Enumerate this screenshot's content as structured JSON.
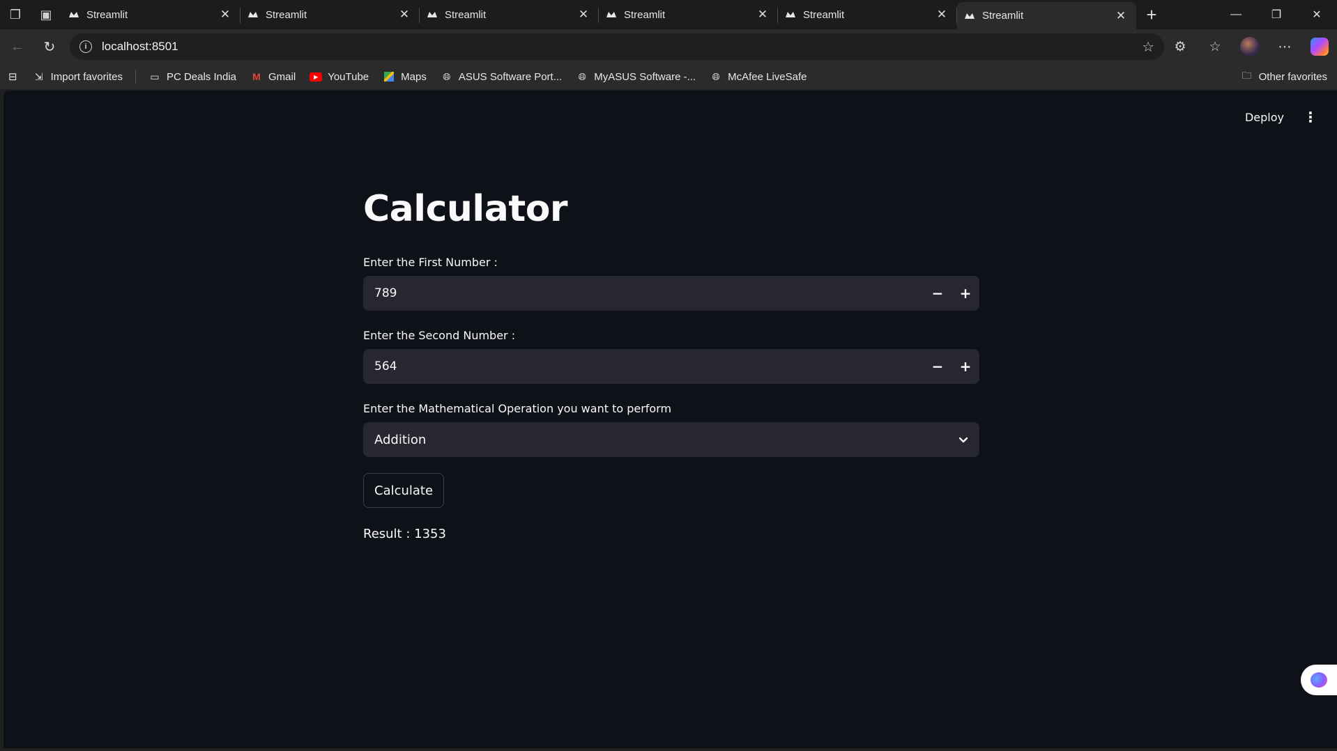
{
  "browser": {
    "tabs": [
      {
        "title": "Streamlit"
      },
      {
        "title": "Streamlit"
      },
      {
        "title": "Streamlit"
      },
      {
        "title": "Streamlit"
      },
      {
        "title": "Streamlit"
      },
      {
        "title": "Streamlit",
        "active": true
      }
    ],
    "url": "localhost:8501",
    "favorites": [
      {
        "label": "Import favorites",
        "icon": "import-icon"
      },
      {
        "label": "PC Deals India",
        "icon": "deals-icon"
      },
      {
        "label": "Gmail",
        "icon": "gmail-icon"
      },
      {
        "label": "YouTube",
        "icon": "youtube-icon"
      },
      {
        "label": "Maps",
        "icon": "maps-icon"
      },
      {
        "label": "ASUS Software Port...",
        "icon": "globe-icon"
      },
      {
        "label": "MyASUS Software -...",
        "icon": "globe-icon"
      },
      {
        "label": "McAfee LiveSafe",
        "icon": "globe-icon"
      }
    ],
    "other_favorites": "Other favorites"
  },
  "app": {
    "deploy_label": "Deploy",
    "title": "Calculator",
    "first": {
      "label": "Enter the First Number :",
      "value": "789"
    },
    "second": {
      "label": "Enter the Second Number :",
      "value": "564"
    },
    "operation": {
      "label": "Enter the Mathematical Operation you want to perform",
      "value": "Addition"
    },
    "calculate_label": "Calculate",
    "result": "Result : 1353"
  },
  "colors": {
    "page_bg": "#0e1117",
    "input_bg": "#262730",
    "text": "#fafafa"
  }
}
